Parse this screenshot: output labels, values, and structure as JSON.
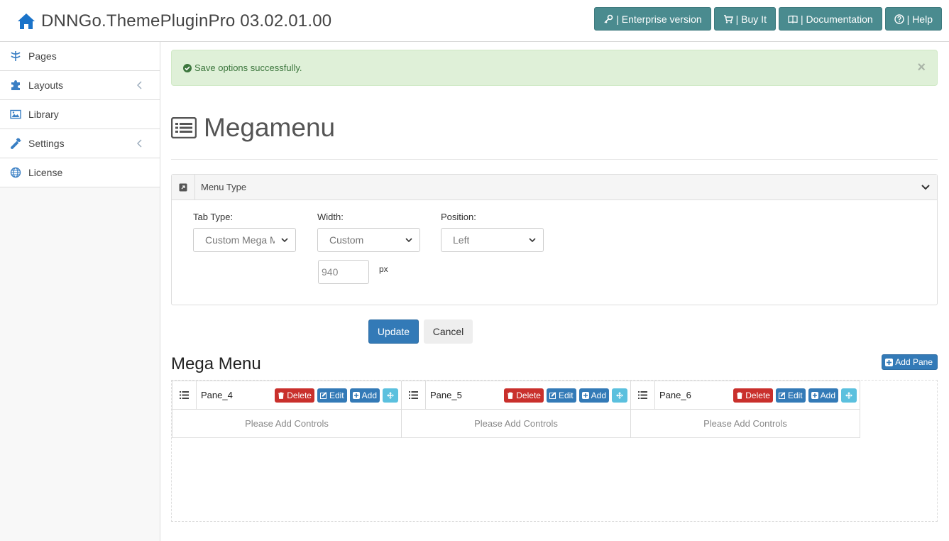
{
  "header": {
    "title": "DNNGo.ThemePluginPro 03.02.01.00",
    "buttons": [
      {
        "label": "| Enterprise version",
        "icon": "key-icon"
      },
      {
        "label": "| Buy It",
        "icon": "cart-icon"
      },
      {
        "label": "| Documentation",
        "icon": "book-icon"
      },
      {
        "label": "| Help",
        "icon": "question-icon"
      }
    ]
  },
  "sidebar": {
    "items": [
      {
        "label": "Pages",
        "icon": "sitemap-icon"
      },
      {
        "label": "Layouts",
        "icon": "puzzle-icon"
      },
      {
        "label": "Library",
        "icon": "image-icon"
      },
      {
        "label": "Settings",
        "icon": "wrench-icon"
      },
      {
        "label": "License",
        "icon": "globe-icon"
      }
    ]
  },
  "alert": {
    "message": "Save options successfully.",
    "close": "×"
  },
  "page": {
    "title": "Megamenu"
  },
  "menu_type": {
    "title": "Menu Type",
    "tab_type_label": "Tab Type:",
    "tab_type_value": "Custom Mega Menu",
    "width_label": "Width:",
    "width_value": "Custom",
    "position_label": "Position:",
    "position_value": "Left",
    "width_px": "940",
    "px_unit": "px"
  },
  "actions": {
    "update": "Update",
    "cancel": "Cancel"
  },
  "mega_menu": {
    "title": "Mega Menu",
    "add_pane": "Add Pane",
    "delete_label": "Delete",
    "edit_label": "Edit",
    "add_label": "Add",
    "panes": [
      {
        "name": "Pane_4",
        "placeholder": "Please Add Controls"
      },
      {
        "name": "Pane_5",
        "placeholder": "Please Add Controls"
      },
      {
        "name": "Pane_6",
        "placeholder": "Please Add Controls"
      }
    ]
  },
  "colors": {
    "primary": "#337ab7",
    "teal": "#4a8b8f",
    "danger": "#c9302c",
    "info": "#5bc0de",
    "success_bg": "#dff0d8"
  }
}
